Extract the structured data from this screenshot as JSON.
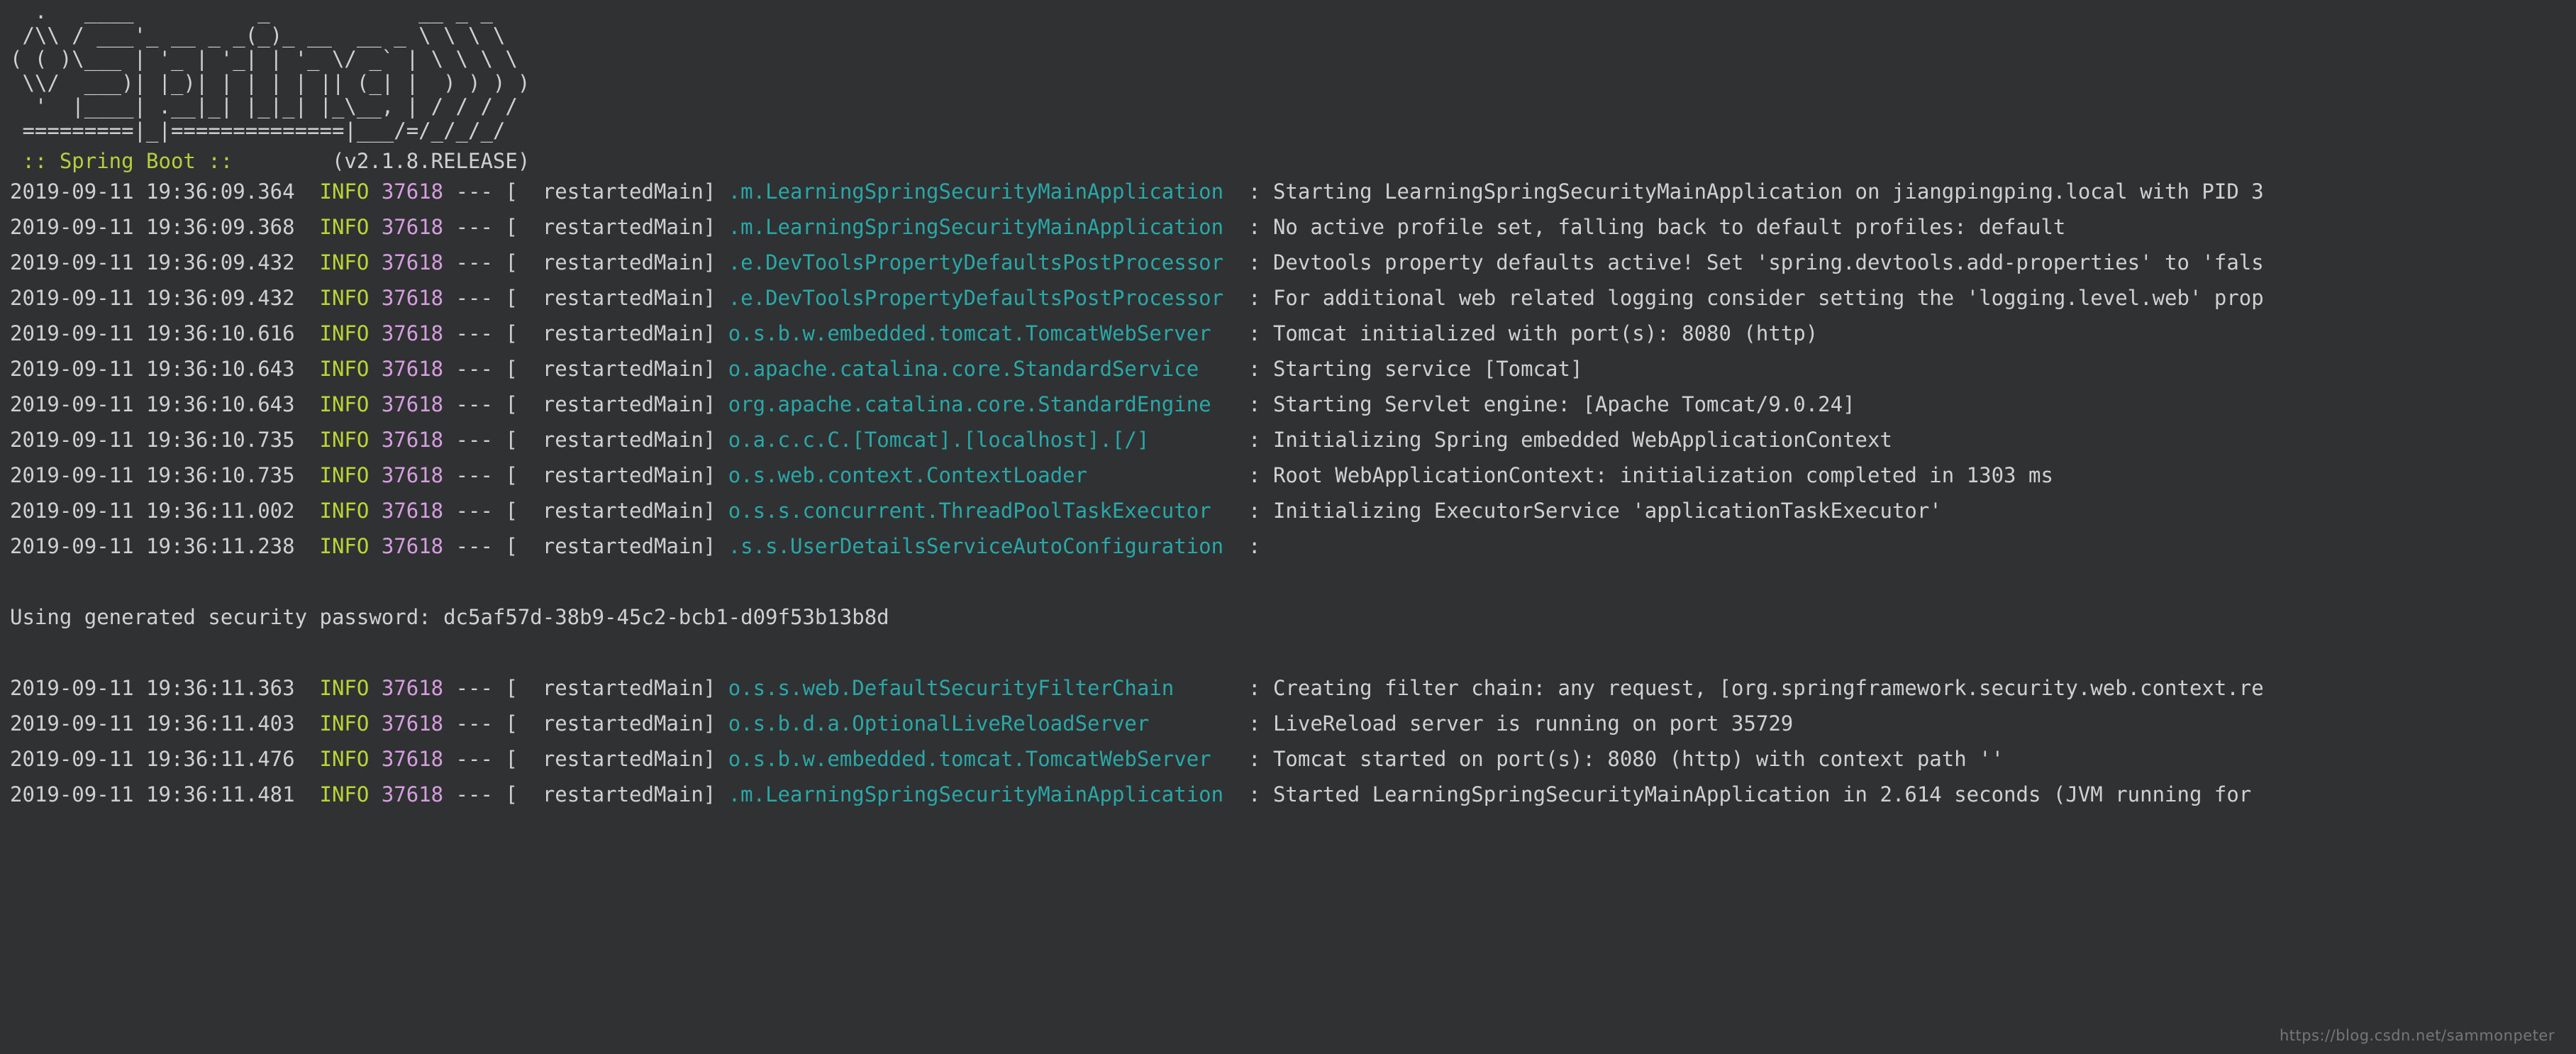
{
  "terminal": {
    "background_color": "#2f3133",
    "foreground_color": "#d0d0d0"
  },
  "banner": {
    "art_lines": [
      "  .   ____          _            __ _ _",
      " /\\\\ / ___'_ __ _ _(_)_ __  __ _ \\ \\ \\ \\",
      "( ( )\\___ | '_ | '_| | '_ \\/ _` | \\ \\ \\ \\",
      " \\\\/  ___)| |_)| | | | | || (_| |  ) ) ) )",
      "  '  |____| .__|_| |_|_| |_\\__, | / / / /",
      " =========|_|==============|___/=/_/_/_/"
    ],
    "spring_label": " :: Spring Boot :: ",
    "version": "       (v2.1.8.RELEASE)",
    "spring_color": "#b5cf3c",
    "version_color": "#d0d0d0"
  },
  "colors": {
    "timestamp": "#d0d0d0",
    "level_info": "#bdd534",
    "pid": "#d69ee0",
    "thread": "#d0d0d0",
    "logger": "#2aa8a8",
    "message": "#d0d0d0"
  },
  "log": {
    "pid": "37618",
    "level": "INFO",
    "thread": "restartedMain",
    "dashes": "---",
    "separator": ":",
    "lines": [
      {
        "type": "log",
        "timestamp": "2019-09-11 19:36:09.364",
        "level": "INFO",
        "pid": "37618",
        "thread": "  restartedMain",
        "logger": ".m.LearningSpringSecurityMainApplication",
        "message": "Starting LearningSpringSecurityMainApplication on jiangpingping.local with PID 3"
      },
      {
        "type": "log",
        "timestamp": "2019-09-11 19:36:09.368",
        "level": "INFO",
        "pid": "37618",
        "thread": "  restartedMain",
        "logger": ".m.LearningSpringSecurityMainApplication",
        "message": "No active profile set, falling back to default profiles: default"
      },
      {
        "type": "log",
        "timestamp": "2019-09-11 19:36:09.432",
        "level": "INFO",
        "pid": "37618",
        "thread": "  restartedMain",
        "logger": ".e.DevToolsPropertyDefaultsPostProcessor",
        "message": "Devtools property defaults active! Set 'spring.devtools.add-properties' to 'fals"
      },
      {
        "type": "log",
        "timestamp": "2019-09-11 19:36:09.432",
        "level": "INFO",
        "pid": "37618",
        "thread": "  restartedMain",
        "logger": ".e.DevToolsPropertyDefaultsPostProcessor",
        "message": "For additional web related logging consider setting the 'logging.level.web' prop"
      },
      {
        "type": "log",
        "timestamp": "2019-09-11 19:36:10.616",
        "level": "INFO",
        "pid": "37618",
        "thread": "  restartedMain",
        "logger": "o.s.b.w.embedded.tomcat.TomcatWebServer",
        "message": "Tomcat initialized with port(s): 8080 (http)"
      },
      {
        "type": "log",
        "timestamp": "2019-09-11 19:36:10.643",
        "level": "INFO",
        "pid": "37618",
        "thread": "  restartedMain",
        "logger": "o.apache.catalina.core.StandardService",
        "message": "Starting service [Tomcat]"
      },
      {
        "type": "log",
        "timestamp": "2019-09-11 19:36:10.643",
        "level": "INFO",
        "pid": "37618",
        "thread": "  restartedMain",
        "logger": "org.apache.catalina.core.StandardEngine",
        "message": "Starting Servlet engine: [Apache Tomcat/9.0.24]"
      },
      {
        "type": "log",
        "timestamp": "2019-09-11 19:36:10.735",
        "level": "INFO",
        "pid": "37618",
        "thread": "  restartedMain",
        "logger": "o.a.c.c.C.[Tomcat].[localhost].[/]",
        "message": "Initializing Spring embedded WebApplicationContext"
      },
      {
        "type": "log",
        "timestamp": "2019-09-11 19:36:10.735",
        "level": "INFO",
        "pid": "37618",
        "thread": "  restartedMain",
        "logger": "o.s.web.context.ContextLoader",
        "message": "Root WebApplicationContext: initialization completed in 1303 ms"
      },
      {
        "type": "log",
        "timestamp": "2019-09-11 19:36:11.002",
        "level": "INFO",
        "pid": "37618",
        "thread": "  restartedMain",
        "logger": "o.s.s.concurrent.ThreadPoolTaskExecutor",
        "message": "Initializing ExecutorService 'applicationTaskExecutor'"
      },
      {
        "type": "log",
        "timestamp": "2019-09-11 19:36:11.238",
        "level": "INFO",
        "pid": "37618",
        "thread": "  restartedMain",
        "logger": ".s.s.UserDetailsServiceAutoConfiguration",
        "message": ""
      },
      {
        "type": "blank"
      },
      {
        "type": "plain",
        "text": "Using generated security password: dc5af57d-38b9-45c2-bcb1-d09f53b13b8d"
      },
      {
        "type": "blank"
      },
      {
        "type": "log",
        "timestamp": "2019-09-11 19:36:11.363",
        "level": "INFO",
        "pid": "37618",
        "thread": "  restartedMain",
        "logger": "o.s.s.web.DefaultSecurityFilterChain",
        "message": "Creating filter chain: any request, [org.springframework.security.web.context.re"
      },
      {
        "type": "log",
        "timestamp": "2019-09-11 19:36:11.403",
        "level": "INFO",
        "pid": "37618",
        "thread": "  restartedMain",
        "logger": "o.s.b.d.a.OptionalLiveReloadServer",
        "message": "LiveReload server is running on port 35729"
      },
      {
        "type": "log",
        "timestamp": "2019-09-11 19:36:11.476",
        "level": "INFO",
        "pid": "37618",
        "thread": "  restartedMain",
        "logger": "o.s.b.w.embedded.tomcat.TomcatWebServer",
        "message": "Tomcat started on port(s): 8080 (http) with context path ''"
      },
      {
        "type": "log",
        "timestamp": "2019-09-11 19:36:11.481",
        "level": "INFO",
        "pid": "37618",
        "thread": "  restartedMain",
        "logger": ".m.LearningSpringSecurityMainApplication",
        "message": "Started LearningSpringSecurityMainApplication in 2.614 seconds (JVM running for"
      }
    ]
  },
  "watermark": {
    "text": "https://blog.csdn.net/sammonpeter"
  }
}
